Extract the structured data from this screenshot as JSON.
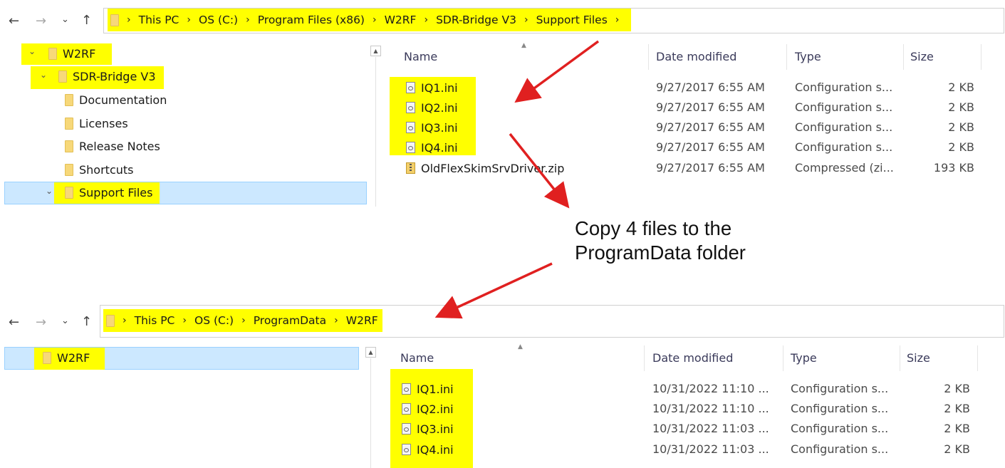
{
  "top": {
    "breadcrumbs": [
      "This PC",
      "OS (C:)",
      "Program Files (x86)",
      "W2RF",
      "SDR-Bridge V3",
      "Support Files"
    ],
    "tree": [
      {
        "label": "W2RF",
        "toggle": "expanded"
      },
      {
        "label": "SDR-Bridge V3",
        "toggle": "expanded"
      },
      {
        "label": "Documentation"
      },
      {
        "label": "Licenses"
      },
      {
        "label": "Release Notes"
      },
      {
        "label": "Shortcuts"
      },
      {
        "label": "Support Files",
        "toggle": "expanded",
        "selected": true
      }
    ],
    "columns": {
      "name": "Name",
      "date": "Date modified",
      "type": "Type",
      "size": "Size"
    },
    "files": [
      {
        "name": "IQ1.ini",
        "date": "9/27/2017 6:55 AM",
        "type": "Configuration s...",
        "size": "2 KB",
        "icon": "config-file-icon"
      },
      {
        "name": "IQ2.ini",
        "date": "9/27/2017 6:55 AM",
        "type": "Configuration s...",
        "size": "2 KB",
        "icon": "config-file-icon"
      },
      {
        "name": "IQ3.ini",
        "date": "9/27/2017 6:55 AM",
        "type": "Configuration s...",
        "size": "2 KB",
        "icon": "config-file-icon"
      },
      {
        "name": "IQ4.ini",
        "date": "9/27/2017 6:55 AM",
        "type": "Configuration s...",
        "size": "2 KB",
        "icon": "config-file-icon"
      },
      {
        "name": "OldFlexSkimSrvDriver.zip",
        "date": "9/27/2017 6:55 AM",
        "type": "Compressed (zi...",
        "size": "193 KB",
        "icon": "zip-file-icon"
      }
    ]
  },
  "callout": {
    "line1": "Copy 4 files to the",
    "line2": "ProgramData folder"
  },
  "bottom": {
    "breadcrumbs": [
      "This PC",
      "OS (C:)",
      "ProgramData",
      "W2RF"
    ],
    "tree": [
      {
        "label": "W2RF",
        "selected": true
      }
    ],
    "columns": {
      "name": "Name",
      "date": "Date modified",
      "type": "Type",
      "size": "Size"
    },
    "files": [
      {
        "name": "IQ1.ini",
        "date": "10/31/2022 11:10 ...",
        "type": "Configuration s...",
        "size": "2 KB",
        "icon": "config-file-icon"
      },
      {
        "name": "IQ2.ini",
        "date": "10/31/2022 11:10 ...",
        "type": "Configuration s...",
        "size": "2 KB",
        "icon": "config-file-icon"
      },
      {
        "name": "IQ3.ini",
        "date": "10/31/2022 11:03 ...",
        "type": "Configuration s...",
        "size": "2 KB",
        "icon": "config-file-icon"
      },
      {
        "name": "IQ4.ini",
        "date": "10/31/2022 11:03 ...",
        "type": "Configuration s...",
        "size": "2 KB",
        "icon": "config-file-icon"
      }
    ]
  },
  "icons": {
    "back": "←",
    "forward": "→",
    "recent": "⌄",
    "up": "↑",
    "separator": "›",
    "expanded": "⌄",
    "sort_caret": "▲",
    "scroll_up": "▲"
  },
  "colors": {
    "highlight": "#ffff00",
    "arrow": "#e02020",
    "selection": "#cce8ff",
    "folder": "#f7d879"
  }
}
